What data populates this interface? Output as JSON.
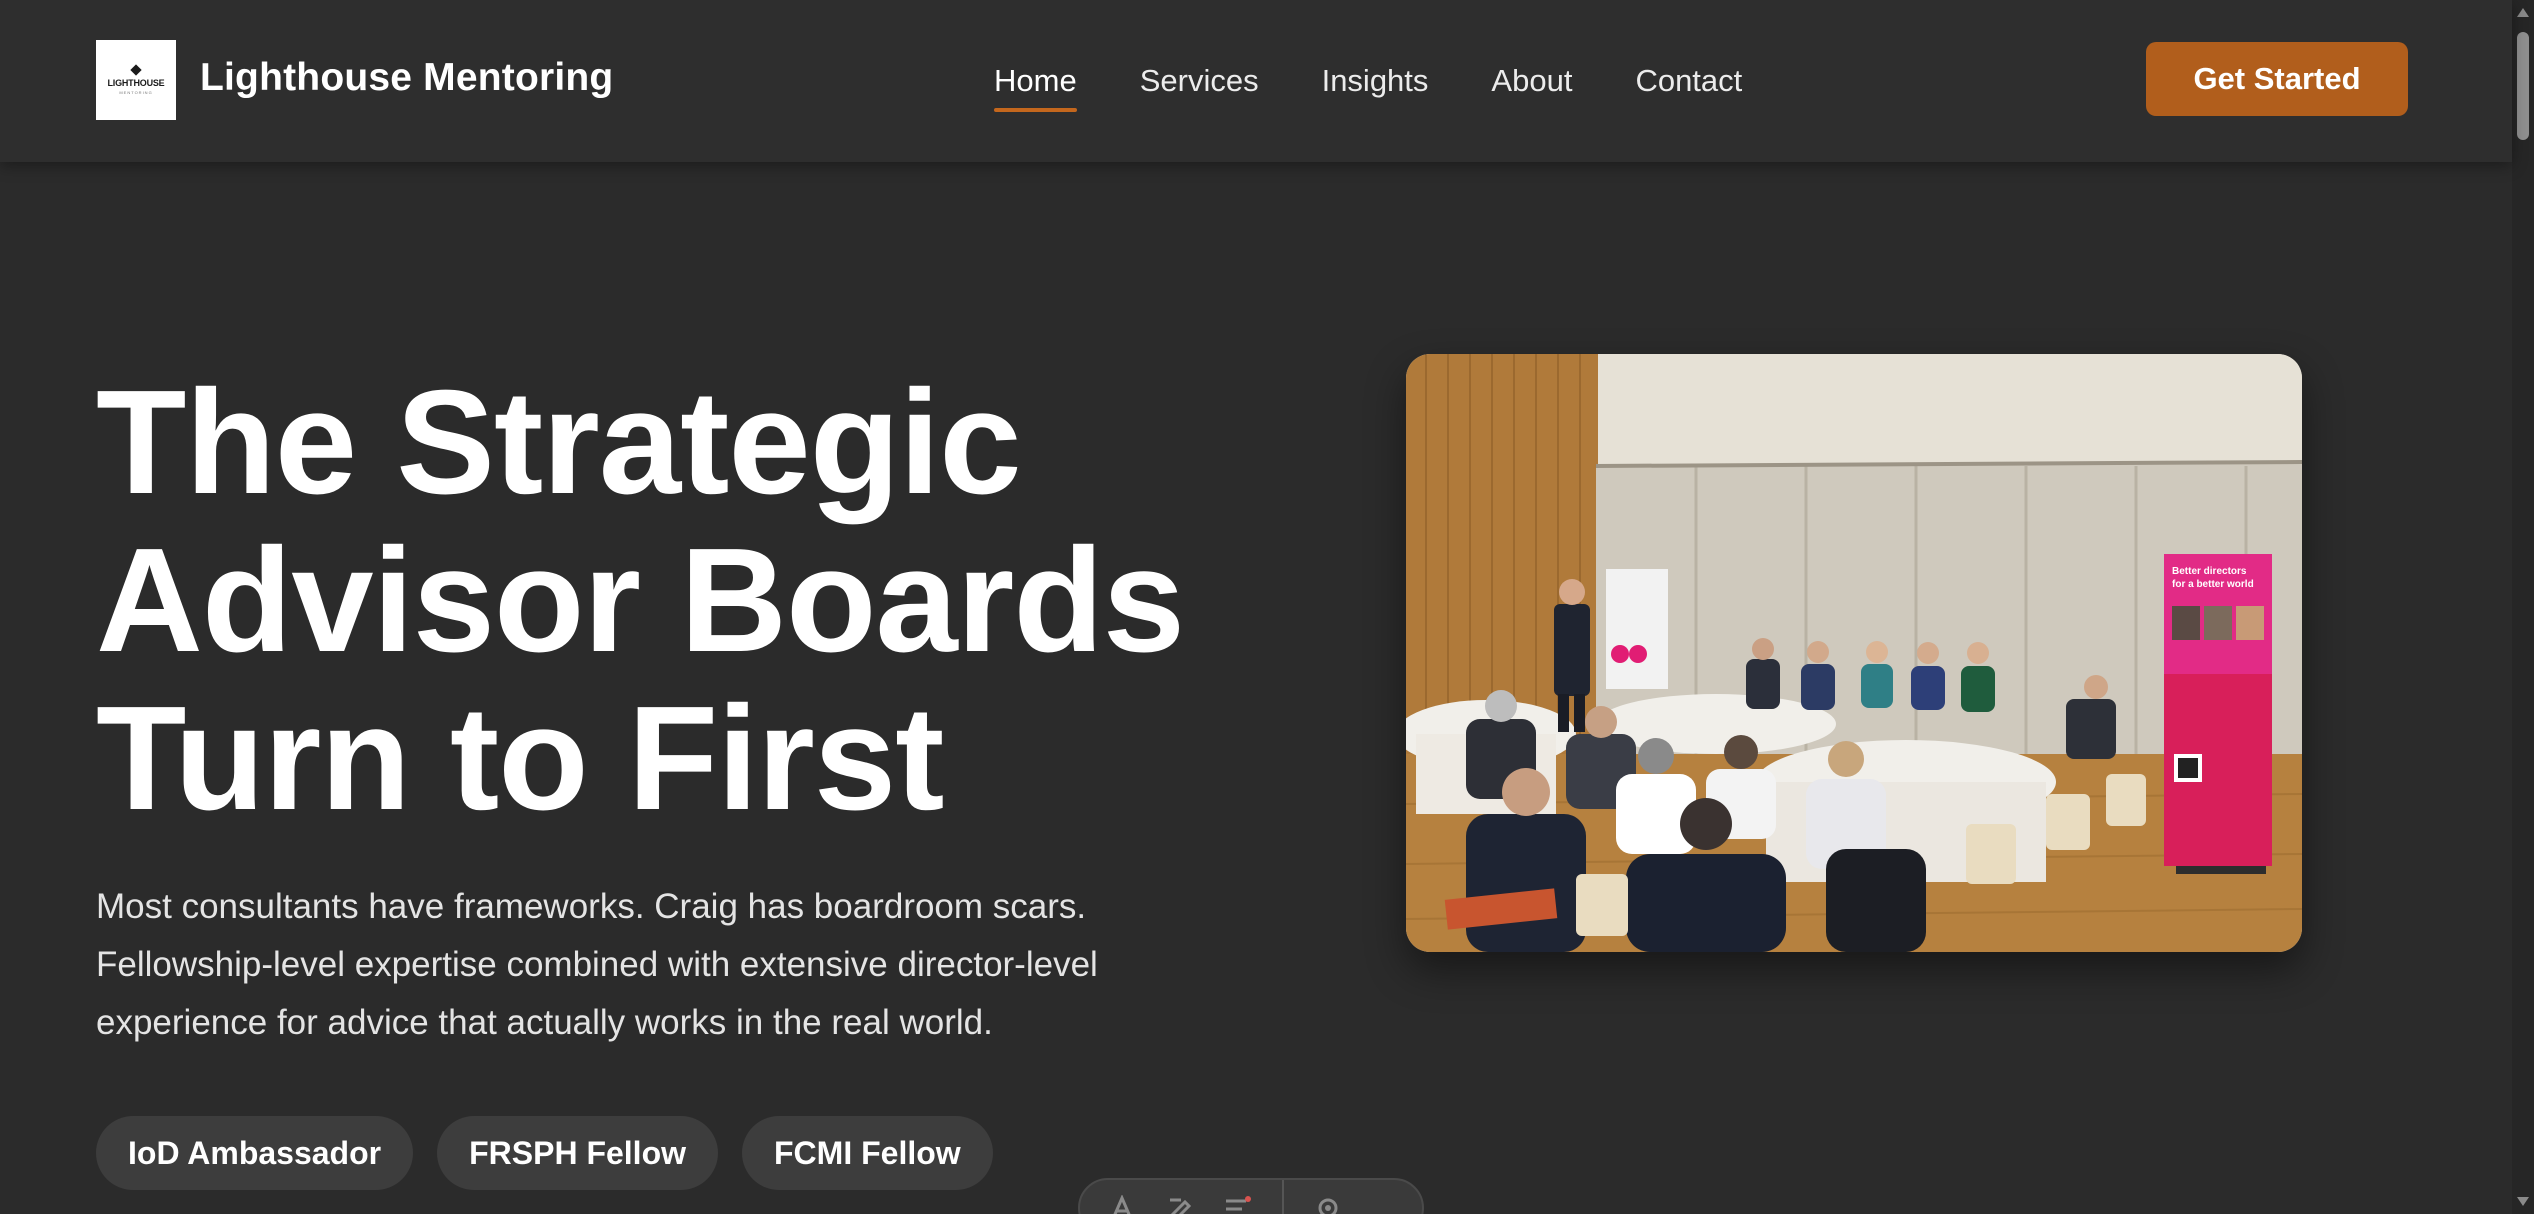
{
  "header": {
    "logo": {
      "word": "LIGHTHOUSE",
      "subword": "MENTORING"
    },
    "brand_name": "Lighthouse Mentoring",
    "nav": [
      {
        "label": "Home",
        "active": true
      },
      {
        "label": "Services",
        "active": false
      },
      {
        "label": "Insights",
        "active": false
      },
      {
        "label": "About",
        "active": false
      },
      {
        "label": "Contact",
        "active": false
      }
    ],
    "cta_label": "Get Started"
  },
  "hero": {
    "title_lines": [
      "The Strategic",
      "Advisor Boards",
      "Turn to First"
    ],
    "subtitle": "Most consultants have frameworks. Craig has boardroom scars. Fellowship-level expertise combined with extensive director-level experience for advice that actually works in the real world.",
    "badges": [
      "IoD Ambassador",
      "FRSPH Fellow",
      "FCMI Fellow"
    ],
    "image": {
      "banner_line_1": "Better directors",
      "banner_line_2": "for a better world"
    }
  },
  "colors": {
    "background": "#2b2b2b",
    "header": "#2e2e2e",
    "accent": "#b15e1c",
    "badge": "#3d3d3d"
  },
  "icons": {
    "dock": [
      "text-icon",
      "pen-icon",
      "lines-icon",
      "settings-icon"
    ]
  }
}
